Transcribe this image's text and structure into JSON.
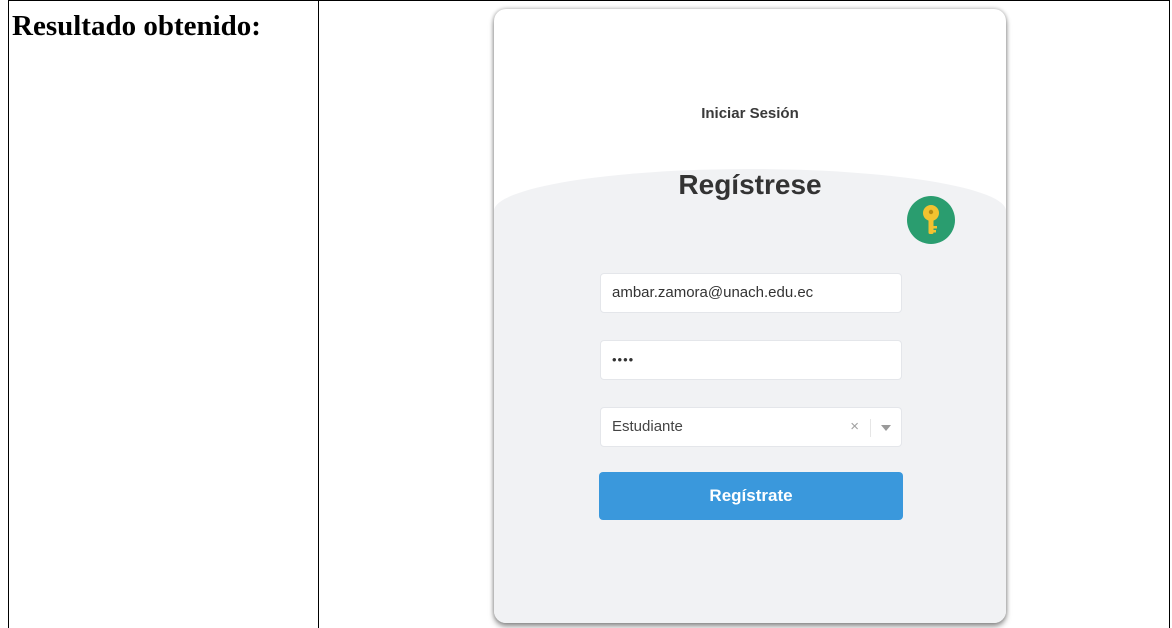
{
  "document": {
    "row_label": "Resultado obtenido:"
  },
  "login_card": {
    "tab_title": "Iniciar Sesión",
    "heading": "Regístrese",
    "badge_icon": "key-icon",
    "badge_color": "#2a9d6f",
    "email_value": "ambar.zamora@unach.edu.ec",
    "password_value": "••••",
    "role_select": {
      "selected": "Estudiante",
      "clear_glyph": "×"
    },
    "submit_label": "Regístrate",
    "submit_color": "#3a98dc"
  }
}
